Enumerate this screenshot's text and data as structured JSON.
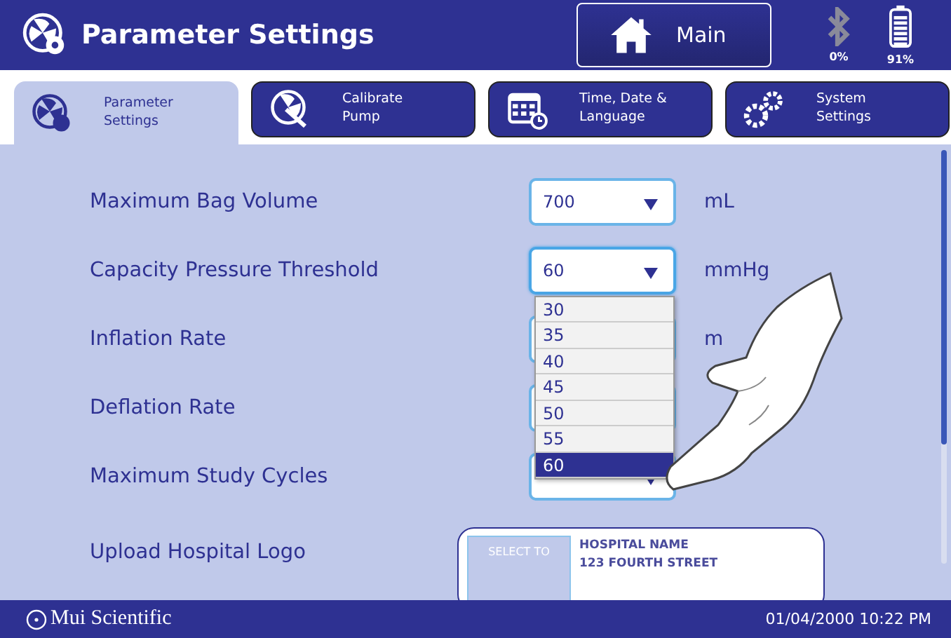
{
  "header": {
    "title": "Parameter Settings",
    "main_button": "Main",
    "bluetooth": "0%",
    "battery": "91%"
  },
  "tabs": [
    {
      "label": "Parameter\nSettings",
      "kind": "fan-gear",
      "selected": true
    },
    {
      "label": "Calibrate\nPump",
      "kind": "fan-wrench",
      "selected": false
    },
    {
      "label": "Time, Date &\nLanguage",
      "kind": "calendar",
      "selected": false
    },
    {
      "label": "System\nSettings",
      "kind": "gears",
      "selected": false
    }
  ],
  "settings": [
    {
      "kind": "select",
      "label": "Maximum Bag Volume",
      "value": "700",
      "unit": "mL",
      "open": false
    },
    {
      "kind": "select",
      "label": "Capacity Pressure Threshold",
      "value": "60",
      "unit": "mmHg",
      "open": true,
      "options": [
        {
          "label": "30",
          "selected": false
        },
        {
          "label": "35",
          "selected": false
        },
        {
          "label": "40",
          "selected": false
        },
        {
          "label": "45",
          "selected": false
        },
        {
          "label": "50",
          "selected": false
        },
        {
          "label": "55",
          "selected": false
        },
        {
          "label": "60",
          "selected": true
        }
      ]
    },
    {
      "kind": "select",
      "label": "Inflation Rate",
      "unit": "m",
      "open": false
    },
    {
      "kind": "select",
      "label": "Deflation Rate",
      "open": false
    },
    {
      "kind": "select",
      "label": "Maximum Study Cycles",
      "open": false
    },
    {
      "kind": "logo",
      "label": "Upload Hospital Logo",
      "button": "SELECT TO",
      "lines": [
        "HOSPITAL NAME",
        "123 FOURTH STREET"
      ]
    }
  ],
  "footer": {
    "brand": "Mui Scientific",
    "datetime": "01/04/2000 10:22 PM"
  }
}
